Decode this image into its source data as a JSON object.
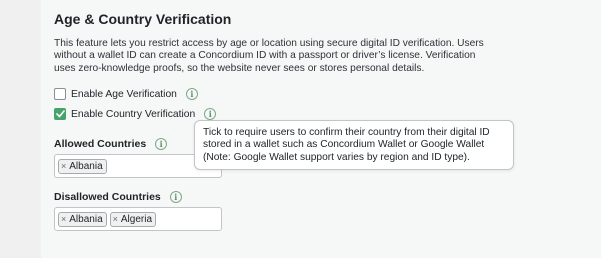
{
  "section": {
    "title": "Age & Country Verification",
    "description": "This feature lets you restrict access by age or location using secure digital ID verification. Users without a wallet ID can create a Concordium ID with a passport or driver’s license. Verification uses zero-knowledge proofs, so the website never sees or stores personal details."
  },
  "options": {
    "age": {
      "label": "Enable Age Verification",
      "checked": false,
      "info_icon": "info-icon"
    },
    "country": {
      "label": "Enable Country Verification",
      "checked": true,
      "info_icon": "info-icon"
    }
  },
  "tooltip": {
    "text": "Tick to require users to confirm their country from their digital ID stored in a wallet such as Concordium Wallet or Google Wallet (Note: Google Wallet support varies by region and ID type)."
  },
  "allowed": {
    "label": "Allowed Countries",
    "tags": [
      "Albania"
    ]
  },
  "disallowed": {
    "label": "Disallowed Countries",
    "tags": [
      "Albania",
      "Algeria"
    ]
  },
  "tag_remove_glyph": "×",
  "info_glyph": "i",
  "colors": {
    "accent_green": "#46a36a",
    "info_icon": "#7fa88a"
  }
}
